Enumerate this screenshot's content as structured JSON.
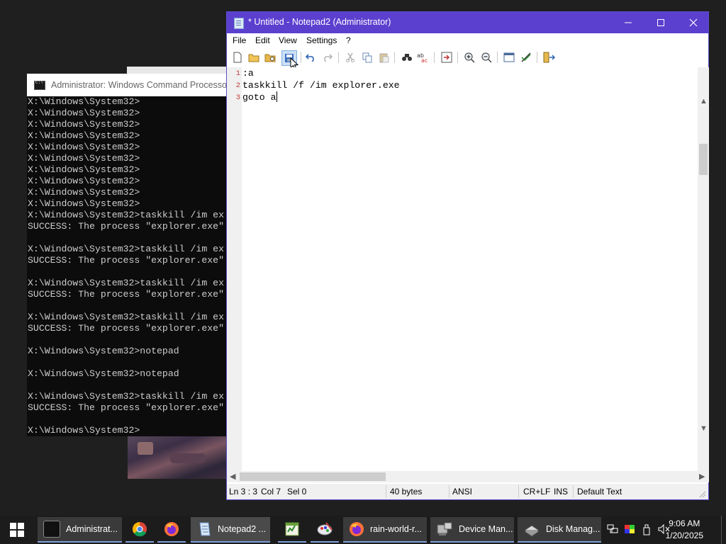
{
  "cmd": {
    "title": "Administrator: Windows Command Processor",
    "lines": [
      "X:\\Windows\\System32>",
      "X:\\Windows\\System32>",
      "X:\\Windows\\System32>",
      "X:\\Windows\\System32>",
      "X:\\Windows\\System32>",
      "X:\\Windows\\System32>",
      "X:\\Windows\\System32>",
      "X:\\Windows\\System32>",
      "X:\\Windows\\System32>",
      "X:\\Windows\\System32>",
      "X:\\Windows\\System32>taskkill /im ex",
      "SUCCESS: The process \"explorer.exe\"",
      "",
      "X:\\Windows\\System32>taskkill /im ex",
      "SUCCESS: The process \"explorer.exe\"",
      "",
      "X:\\Windows\\System32>taskkill /im ex",
      "SUCCESS: The process \"explorer.exe\"",
      "",
      "X:\\Windows\\System32>taskkill /im ex",
      "SUCCESS: The process \"explorer.exe\"",
      "",
      "X:\\Windows\\System32>notepad",
      "",
      "X:\\Windows\\System32>notepad",
      "",
      "X:\\Windows\\System32>taskkill /im ex",
      "SUCCESS: The process \"explorer.exe\"",
      "",
      "X:\\Windows\\System32>"
    ]
  },
  "notepad": {
    "title": "* Untitled - Notepad2 (Administrator)",
    "menu": [
      "File",
      "Edit",
      "View",
      "Settings",
      "?"
    ],
    "lines": [
      {
        "num": "1",
        "text": ":a"
      },
      {
        "num": "2",
        "text": "taskkill /f /im explorer.exe"
      },
      {
        "num": "3",
        "text": "goto a"
      }
    ],
    "status": {
      "position": "Ln 3 : 3",
      "col": "Col 7",
      "sel": "Sel 0",
      "size": "40 bytes",
      "encoding": "ANSI",
      "line_ending": "CR+LF",
      "mode": "INS",
      "scheme": "Default Text"
    }
  },
  "taskbar": {
    "items": [
      {
        "label": "Administrat...",
        "icon": "cmd-icon"
      },
      {
        "label": "",
        "icon": "chrome-icon"
      },
      {
        "label": "",
        "icon": "firefox-icon"
      },
      {
        "label": "Notepad2 ...",
        "icon": "notepad2-icon"
      },
      {
        "label": "",
        "icon": "spreadsheet-icon"
      },
      {
        "label": "",
        "icon": "paint-icon"
      },
      {
        "label": "rain-world-r...",
        "icon": "firefox-icon"
      },
      {
        "label": "Device Man...",
        "icon": "device-manager-icon"
      },
      {
        "label": "Disk Manag...",
        "icon": "disk-management-icon"
      }
    ],
    "time": "9:06 AM",
    "date": "1/20/2025"
  },
  "colors": {
    "notepad_title": "#5b40cf",
    "cmd_bg": "#0c0c0c",
    "taskbar": "#1c1c1c"
  }
}
